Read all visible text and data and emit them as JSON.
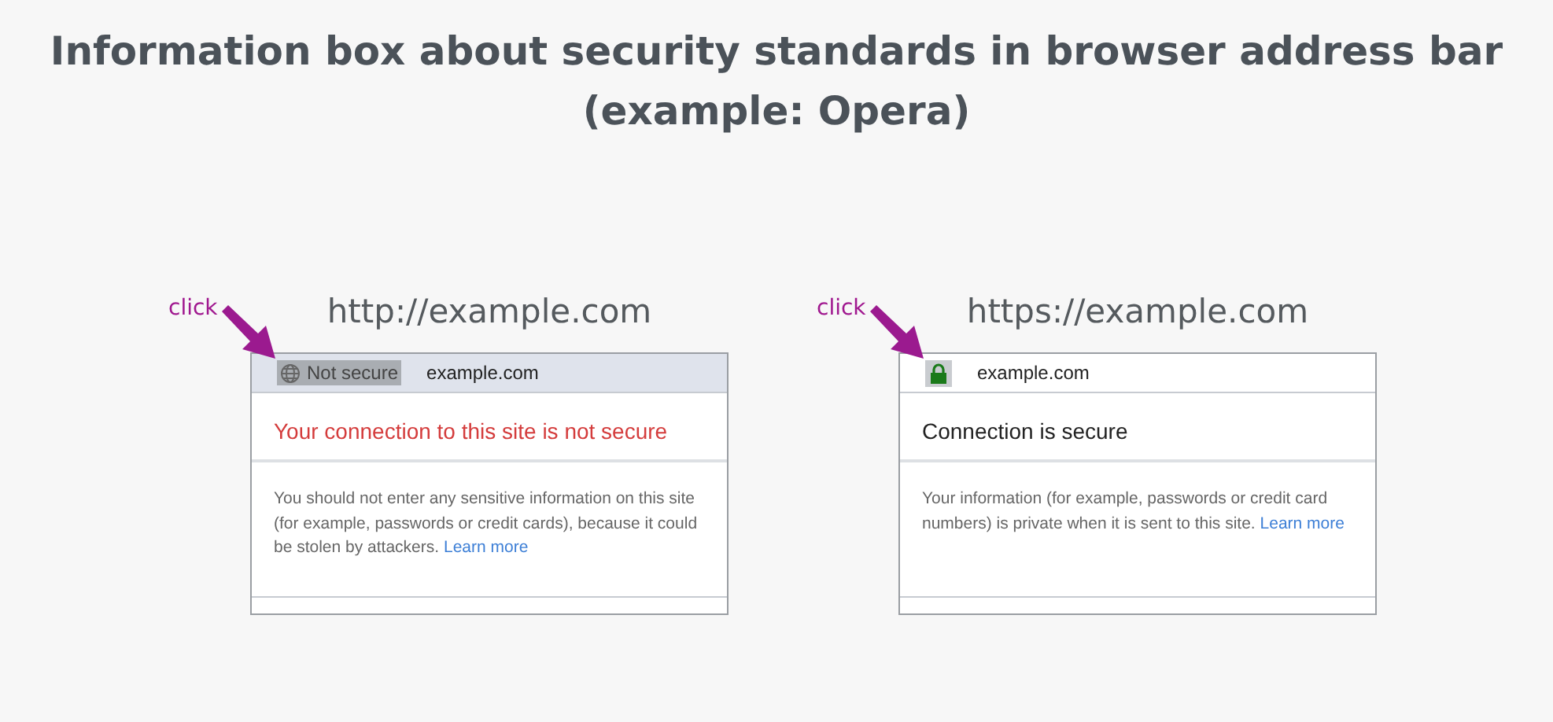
{
  "title": "Information box about security standards in browser address bar (example: Opera)",
  "panels": [
    {
      "kind": "insecure",
      "caption": "http://example.com",
      "click_label": "click",
      "security_label": "Not secure",
      "host": "example.com",
      "heading": "Your connection to this site is not secure",
      "body": "You should not enter any sensitive information on this site (for example, passwords or credit cards), because it could be stolen by attackers.",
      "link": "Learn more"
    },
    {
      "kind": "secure",
      "caption": "https://example.com",
      "click_label": "click",
      "host": "example.com",
      "heading": "Connection is secure",
      "body": "Your information (for example, passwords or credit card numbers) is private when it is sent to this site.",
      "link": "Learn more"
    }
  ]
}
